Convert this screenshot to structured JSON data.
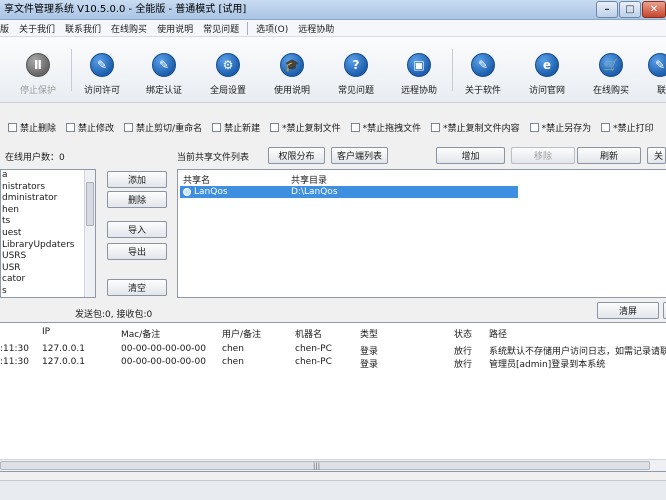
{
  "window": {
    "title": "享文件管理系统 V10.5.0.0 - 全能版 - 普通模式 [试用]"
  },
  "menu": {
    "items": [
      "版",
      "关于我们",
      "联系我们",
      "在线购买",
      "使用说明",
      "常见问题"
    ],
    "items2": [
      "选项(O)",
      "远程协助"
    ]
  },
  "toolbar": {
    "tools": [
      {
        "label": "停止保护",
        "icon": "pause-icon",
        "glyph": "Ⅱ",
        "disabled": true
      },
      {
        "label": "访问许可",
        "icon": "pen-icon",
        "glyph": "✎"
      },
      {
        "label": "绑定认证",
        "icon": "pen-icon",
        "glyph": "✎"
      },
      {
        "label": "全局设置",
        "icon": "gear-icon",
        "glyph": "⚙"
      },
      {
        "label": "使用说明",
        "icon": "graduation-cap-icon",
        "glyph": "🎓"
      },
      {
        "label": "常见问题",
        "icon": "question-icon",
        "glyph": "?"
      },
      {
        "label": "远程协助",
        "icon": "remote-screen-icon",
        "glyph": "▣"
      },
      {
        "label": "关于软件",
        "icon": "pen-icon",
        "glyph": "✎"
      },
      {
        "label": "访问官网",
        "icon": "browser-icon",
        "glyph": "e"
      },
      {
        "label": "在线购买",
        "icon": "cart-icon",
        "glyph": "🛒"
      },
      {
        "label": "联",
        "icon": "pen-icon",
        "glyph": "✎"
      }
    ]
  },
  "checks": [
    "禁止删除",
    "禁止修改",
    "禁止剪切/重命名",
    "禁止新建",
    "*禁止复制文件",
    "*禁止拖拽文件",
    "*禁止复制文件内容",
    "*禁止另存为",
    "*禁止打印"
  ],
  "users": {
    "online_label": "在线用户数：0",
    "items": [
      "a",
      "nistrators",
      "dministrator",
      "hen",
      "ts",
      "uest",
      "LibraryUpdaters",
      "USRS",
      "USR",
      "cator",
      "s"
    ]
  },
  "user_buttons": {
    "add": "添加",
    "remove": "删除",
    "import": "导入",
    "export": "导出",
    "clear": "清空"
  },
  "shares": {
    "title": "当前共享文件列表",
    "perm_btn": "权限分布",
    "client_btn": "客户端列表",
    "add_btn": "增加",
    "remove_btn": "移除",
    "refresh_btn": "刷新",
    "next_btn": "关",
    "col_name": "共享名",
    "col_dir": "共享目录",
    "rows": [
      {
        "name": "LanQos",
        "dir": "D:\\LanQos"
      }
    ]
  },
  "traffic": {
    "label": "发送包:0, 接收包:0",
    "clear_btn": "清屏"
  },
  "log": {
    "columns": [
      "",
      "IP",
      "Mac/备注",
      "用户/备注",
      "机器名",
      "类型",
      "状态",
      "路径"
    ],
    "rows": [
      {
        "time": ":11:30",
        "ip": "127.0.0.1",
        "mac": "00-00-00-00-00-00",
        "user": "chen",
        "machine": "chen-PC",
        "type": "登录",
        "status": "放行",
        "path": "系统默认不存储用户访问日志，如需记录请联"
      },
      {
        "time": ":11:30",
        "ip": "127.0.0.1",
        "mac": "00-00-00-00-00-00",
        "user": "chen",
        "machine": "chen-PC",
        "type": "登录",
        "status": "放行",
        "path": "管理员[admin]登录到本系统"
      }
    ]
  }
}
